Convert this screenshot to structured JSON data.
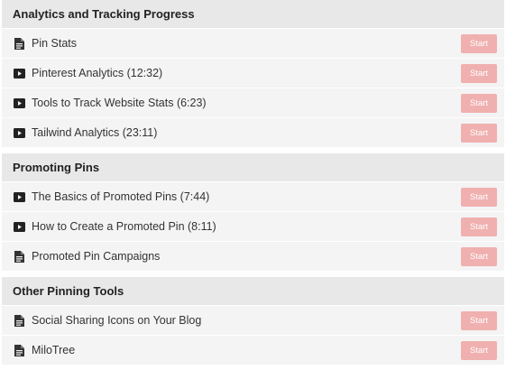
{
  "sections": [
    {
      "title": "Analytics and Tracking Progress",
      "lectures": [
        {
          "title": "Pin Stats",
          "icon": "document-icon",
          "action": "Start"
        },
        {
          "title": "Pinterest Analytics (12:32)",
          "icon": "video-icon",
          "action": "Start"
        },
        {
          "title": "Tools to Track Website Stats (6:23)",
          "icon": "video-icon",
          "action": "Start"
        },
        {
          "title": "Tailwind Analytics (23:11)",
          "icon": "video-icon",
          "action": "Start"
        }
      ]
    },
    {
      "title": "Promoting Pins",
      "lectures": [
        {
          "title": "The Basics of Promoted Pins (7:44)",
          "icon": "video-icon",
          "action": "Start"
        },
        {
          "title": "How to Create a Promoted Pin (8:11)",
          "icon": "video-icon",
          "action": "Start"
        },
        {
          "title": "Promoted Pin Campaigns",
          "icon": "document-icon",
          "action": "Start"
        }
      ]
    },
    {
      "title": "Other Pinning Tools",
      "lectures": [
        {
          "title": "Social Sharing Icons on Your Blog",
          "icon": "document-icon",
          "action": "Start"
        },
        {
          "title": "MiloTree",
          "icon": "document-icon",
          "action": "Start"
        }
      ]
    }
  ],
  "colors": {
    "section_header_bg": "#e8e8e8",
    "lecture_bg": "#f4f4f4",
    "start_button_bg": "#f0b0b0",
    "start_button_text": "#ffffff",
    "icon": "#333333"
  }
}
